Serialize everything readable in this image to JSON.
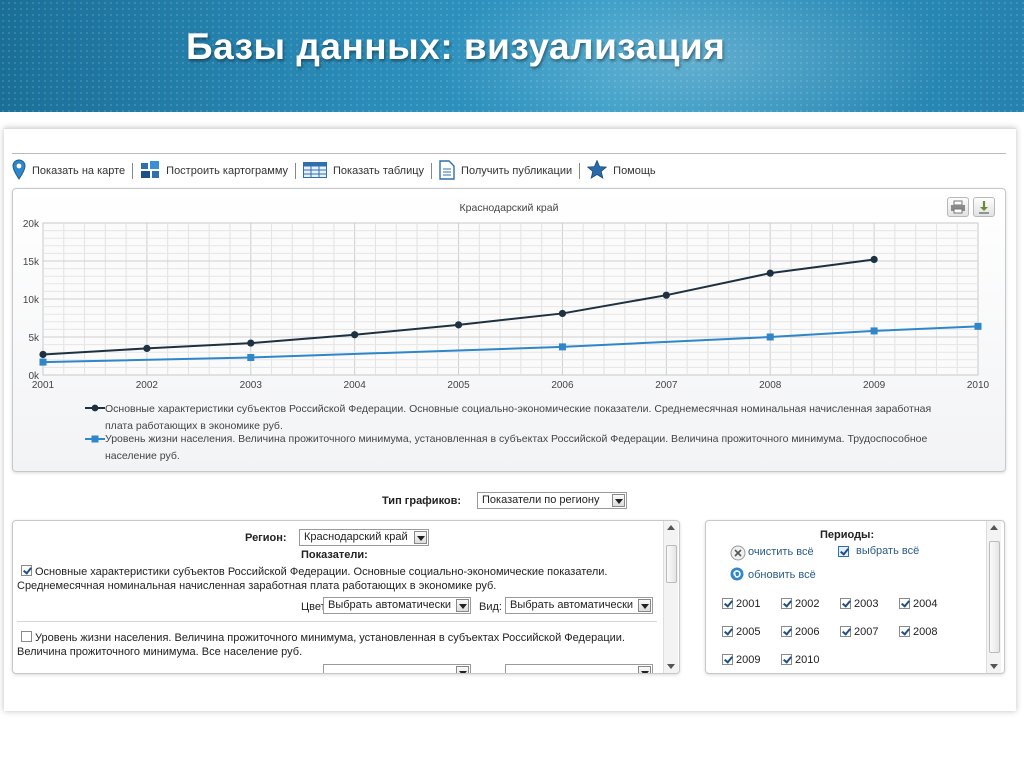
{
  "slide": {
    "title": "Базы данных: визуализация"
  },
  "toolbar": {
    "items": [
      {
        "label": "Показать на карте",
        "icon": "map-pin-icon"
      },
      {
        "label": "Построить картограмму",
        "icon": "cartogram-icon"
      },
      {
        "label": "Показать таблицу",
        "icon": "table-icon"
      },
      {
        "label": "Получить публикации",
        "icon": "document-icon"
      },
      {
        "label": "Помощь",
        "icon": "star-icon"
      }
    ]
  },
  "chart_data": {
    "type": "line",
    "title": "Краснодарский край",
    "x": [
      "2001",
      "2002",
      "2003",
      "2004",
      "2005",
      "2006",
      "2007",
      "2008",
      "2009",
      "2010"
    ],
    "y_ticks": [
      "0k",
      "5k",
      "10k",
      "15k",
      "20k"
    ],
    "ylim": [
      0,
      20000
    ],
    "grid": true,
    "legend_placement": "bottom",
    "series": [
      {
        "name": "Основные характеристики субъектов Российской Федерации. Основные социально-экономические показатели. Среднемесячная номинальная начисленная заработная плата работающих в экономике руб.",
        "color": "#1e3142",
        "marker": "circle",
        "values": [
          2700,
          3500,
          4200,
          5300,
          6600,
          8100,
          10500,
          13400,
          15200,
          null
        ]
      },
      {
        "name": "Уровень жизни населения. Величина прожиточного минимума, установленная в субъектах Российской Федерации. Величина прожиточного минимума. Трудоспособное население руб.",
        "color": "#2f86c9",
        "marker": "square",
        "values": [
          1700,
          null,
          2300,
          null,
          null,
          3700,
          null,
          5000,
          5800,
          6400
        ]
      }
    ]
  },
  "chart_tools": {
    "print_icon": "printer-icon",
    "download_icon": "download-icon"
  },
  "graph_type": {
    "label": "Тип графиков:",
    "value": "Показатели по региону"
  },
  "indicators": {
    "region_label": "Регион:",
    "region_value": "Краснодарский край",
    "heading": "Показатели:",
    "items": [
      {
        "checked": true,
        "line1": "Основные характеристики субъектов Российской Федерации. Основные социально-экономические показатели.",
        "line2": "Среднемесячная номинальная начисленная заработная плата работающих в экономике руб.",
        "color_label": "Цвет:",
        "color_value": "Выбрать автоматически",
        "view_label": "Вид:",
        "view_value": "Выбрать автоматически"
      },
      {
        "checked": false,
        "line1": "Уровень жизни населения. Величина прожиточного минимума, установленная в субъектах Российской Федерации.",
        "line2": "Величина прожиточного минимума. Все население руб."
      }
    ]
  },
  "periods": {
    "heading": "Периоды:",
    "clear_all": "очистить всё",
    "select_all": "выбрать всё",
    "refresh_all": "обновить всё",
    "years": [
      {
        "label": "2001",
        "checked": true
      },
      {
        "label": "2002",
        "checked": true
      },
      {
        "label": "2003",
        "checked": true
      },
      {
        "label": "2004",
        "checked": true
      },
      {
        "label": "2005",
        "checked": true
      },
      {
        "label": "2006",
        "checked": true
      },
      {
        "label": "2007",
        "checked": true
      },
      {
        "label": "2008",
        "checked": true
      },
      {
        "label": "2009",
        "checked": true
      },
      {
        "label": "2010",
        "checked": true
      }
    ]
  }
}
